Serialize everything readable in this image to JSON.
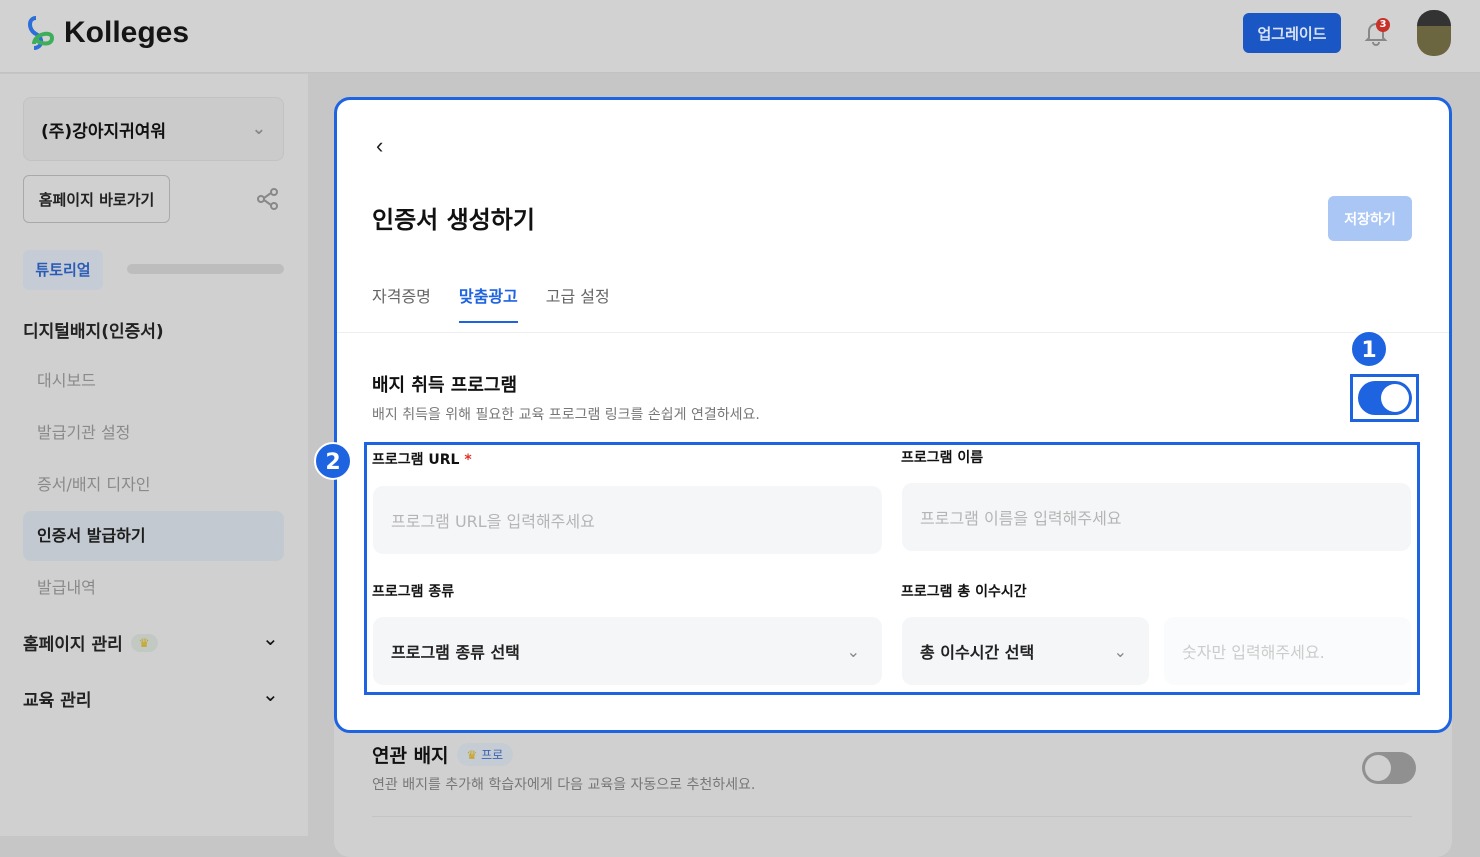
{
  "header": {
    "brand": "Kolleges",
    "upgrade": "업그레이드",
    "notifications": "3"
  },
  "sidebar": {
    "org": "(주)강아지귀여워",
    "homepage": "홈페이지 바로가기",
    "tutorial": "튜토리얼",
    "tutorial_progress": 0,
    "section": "디지털배지(인증서)",
    "items": [
      {
        "label": "대시보드"
      },
      {
        "label": "발급기관 설정"
      },
      {
        "label": "증서/배지 디자인"
      },
      {
        "label": "인증서 발급하기"
      },
      {
        "label": "발급내역"
      }
    ],
    "homepage_mgmt": "홈페이지 관리",
    "edu_mgmt": "교육 관리"
  },
  "main": {
    "title": "인증서 생성하기",
    "save": "저장하기",
    "tabs": [
      {
        "label": "자격증명"
      },
      {
        "label": "맞춤광고"
      },
      {
        "label": "고급 설정"
      }
    ],
    "badge_program": {
      "title": "배지 취득 프로그램",
      "desc": "배지 취득을 위해 필요한 교육 프로그램 링크를 손쉽게 연결하세요.",
      "enabled": true
    },
    "fields": {
      "url_label": "프로그램 URL",
      "required": "*",
      "url_placeholder": "프로그램 URL을 입력해주세요",
      "name_label": "프로그램 이름",
      "name_placeholder": "프로그램 이름을 입력해주세요",
      "type_label": "프로그램 종류",
      "type_value": "프로그램 종류 선택",
      "hours_label": "프로그램 총 이수시간",
      "hours_value": "총 이수시간 선택",
      "hours_placeholder": "숫자만 입력해주세요."
    },
    "related": {
      "title": "연관 배지",
      "badge": "프로",
      "desc": "연관 배지를 추가해 학습자에게 다음 교육을 자동으로 추천하세요.",
      "enabled": false
    }
  },
  "callouts": [
    "1",
    "2"
  ]
}
